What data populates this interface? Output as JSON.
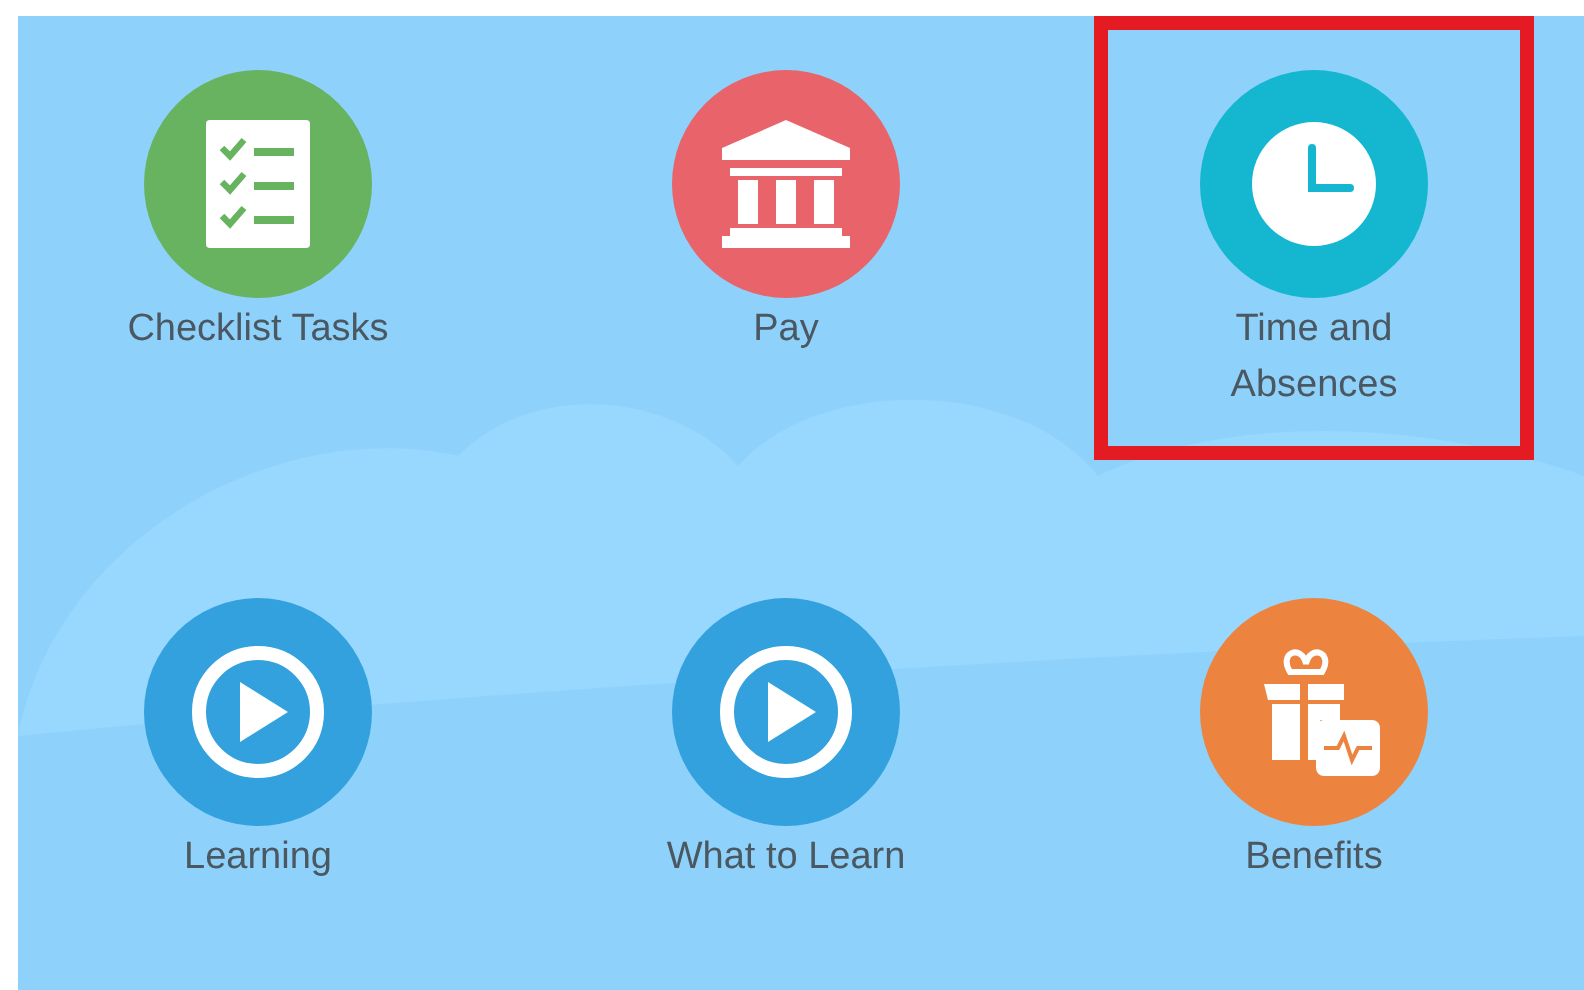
{
  "tiles": [
    {
      "label": "Checklist Tasks",
      "kind": "checklist",
      "color": "#67b35f",
      "highlighted": false
    },
    {
      "label": "Pay",
      "kind": "bank",
      "color": "#e8636a",
      "highlighted": false
    },
    {
      "label": "Time and Absences",
      "kind": "clock",
      "color": "#15b6cf",
      "highlighted": true
    },
    {
      "label": "Learning",
      "kind": "play",
      "color": "#33a1dd",
      "highlighted": false
    },
    {
      "label": "What to Learn",
      "kind": "play",
      "color": "#33a1dd",
      "highlighted": false
    },
    {
      "label": "Benefits",
      "kind": "gift",
      "color": "#ec843f",
      "highlighted": false
    }
  ]
}
